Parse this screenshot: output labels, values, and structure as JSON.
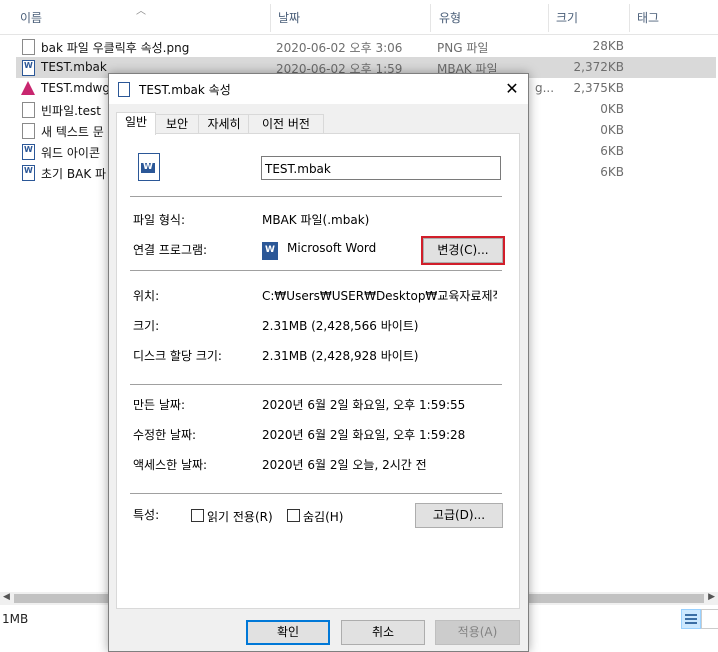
{
  "explorer": {
    "columns": {
      "name": "이름",
      "date": "날짜",
      "type": "유형",
      "size": "크기",
      "tags": "태그"
    },
    "files": [
      {
        "name": "bak 파일 우클릭후 속성.png",
        "date": "2020-06-02 오후 3:06",
        "type": "PNG 파일",
        "size": "28KB",
        "icon": "image-file-icon"
      },
      {
        "name": "TEST.mbak",
        "date": "2020-06-02 오후 1:59",
        "type": "MBAK 파일",
        "size": "2,372KB",
        "icon": "word-file-icon"
      },
      {
        "name": "TEST.mdwg",
        "date": "",
        "type": "g...",
        "size": "2,375KB",
        "icon": "dwg-file-icon"
      },
      {
        "name": "빈파일.test",
        "date": "",
        "type": "",
        "size": "0KB",
        "icon": "blank-file-icon"
      },
      {
        "name": "새 텍스트 문",
        "date": "",
        "type": "",
        "size": "0KB",
        "icon": "text-file-icon"
      },
      {
        "name": "워드 아이콘",
        "date": "",
        "type": "",
        "size": "6KB",
        "icon": "word-file-icon"
      },
      {
        "name": "초기 BAK 파",
        "date": "",
        "type": "",
        "size": "6KB",
        "icon": "word-file-icon"
      }
    ],
    "status": "1MB"
  },
  "dialog": {
    "title": "TEST.mbak 속성",
    "close_label": "✕",
    "tabs": [
      "일반",
      "보안",
      "자세히",
      "이전 버전"
    ],
    "filename": "TEST.mbak",
    "labels": {
      "file_type": "파일 형식:",
      "opens_with": "연결 프로그램:",
      "location": "위치:",
      "size": "크기:",
      "size_on_disk": "디스크 할당 크기:",
      "created": "만든 날짜:",
      "modified": "수정한 날짜:",
      "accessed": "액세스한 날짜:",
      "attributes": "특성:"
    },
    "values": {
      "file_type": "MBAK 파일(.mbak)",
      "opens_with": "Microsoft Word",
      "location": "C:₩Users₩USER₩Desktop₩교육자료제작₩.ba",
      "size": "2.31MB (2,428,566 바이트)",
      "size_on_disk": "2.31MB (2,428,928 바이트)",
      "created": "2020년 6월 2일 화요일, 오후 1:59:55",
      "modified": "2020년 6월 2일 화요일, 오후 1:59:28",
      "accessed": "2020년 6월 2일 오늘, 2시간 전"
    },
    "buttons": {
      "change": "변경(C)...",
      "advanced": "고급(D)...",
      "ok": "확인",
      "cancel": "취소",
      "apply": "적용(A)"
    },
    "checkboxes": {
      "readonly": "읽기 전용(R)",
      "hidden": "숨김(H)"
    },
    "highlight_color": "#d11e2a"
  }
}
